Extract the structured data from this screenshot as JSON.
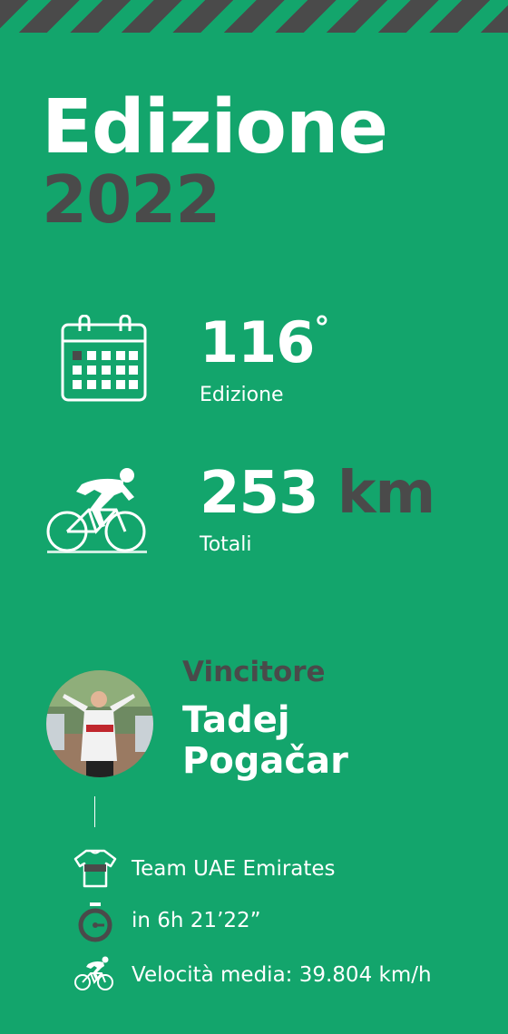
{
  "header": {
    "title": "Edizione",
    "year": "2022"
  },
  "stats": {
    "edition": {
      "value": "116",
      "suffix": "°",
      "label": "Edizione",
      "icon": "calendar-icon"
    },
    "distance": {
      "value": "253",
      "unit": "km",
      "label": "Totali",
      "icon": "cyclist-icon"
    }
  },
  "winner": {
    "label": "Vincitore",
    "first_name": "Tadej",
    "last_name": "Pogačar",
    "photo": "winner-photo",
    "team": "Team UAE Emirates",
    "time": "in 6h 21’22”",
    "speed": "Velocità media: 39.804 km/h",
    "team_icon": "jersey-icon",
    "time_icon": "stopwatch-icon",
    "speed_icon": "cyclist-small-icon"
  },
  "colors": {
    "background": "#13a56c",
    "dark": "#4a4a4a",
    "text": "#ffffff"
  }
}
